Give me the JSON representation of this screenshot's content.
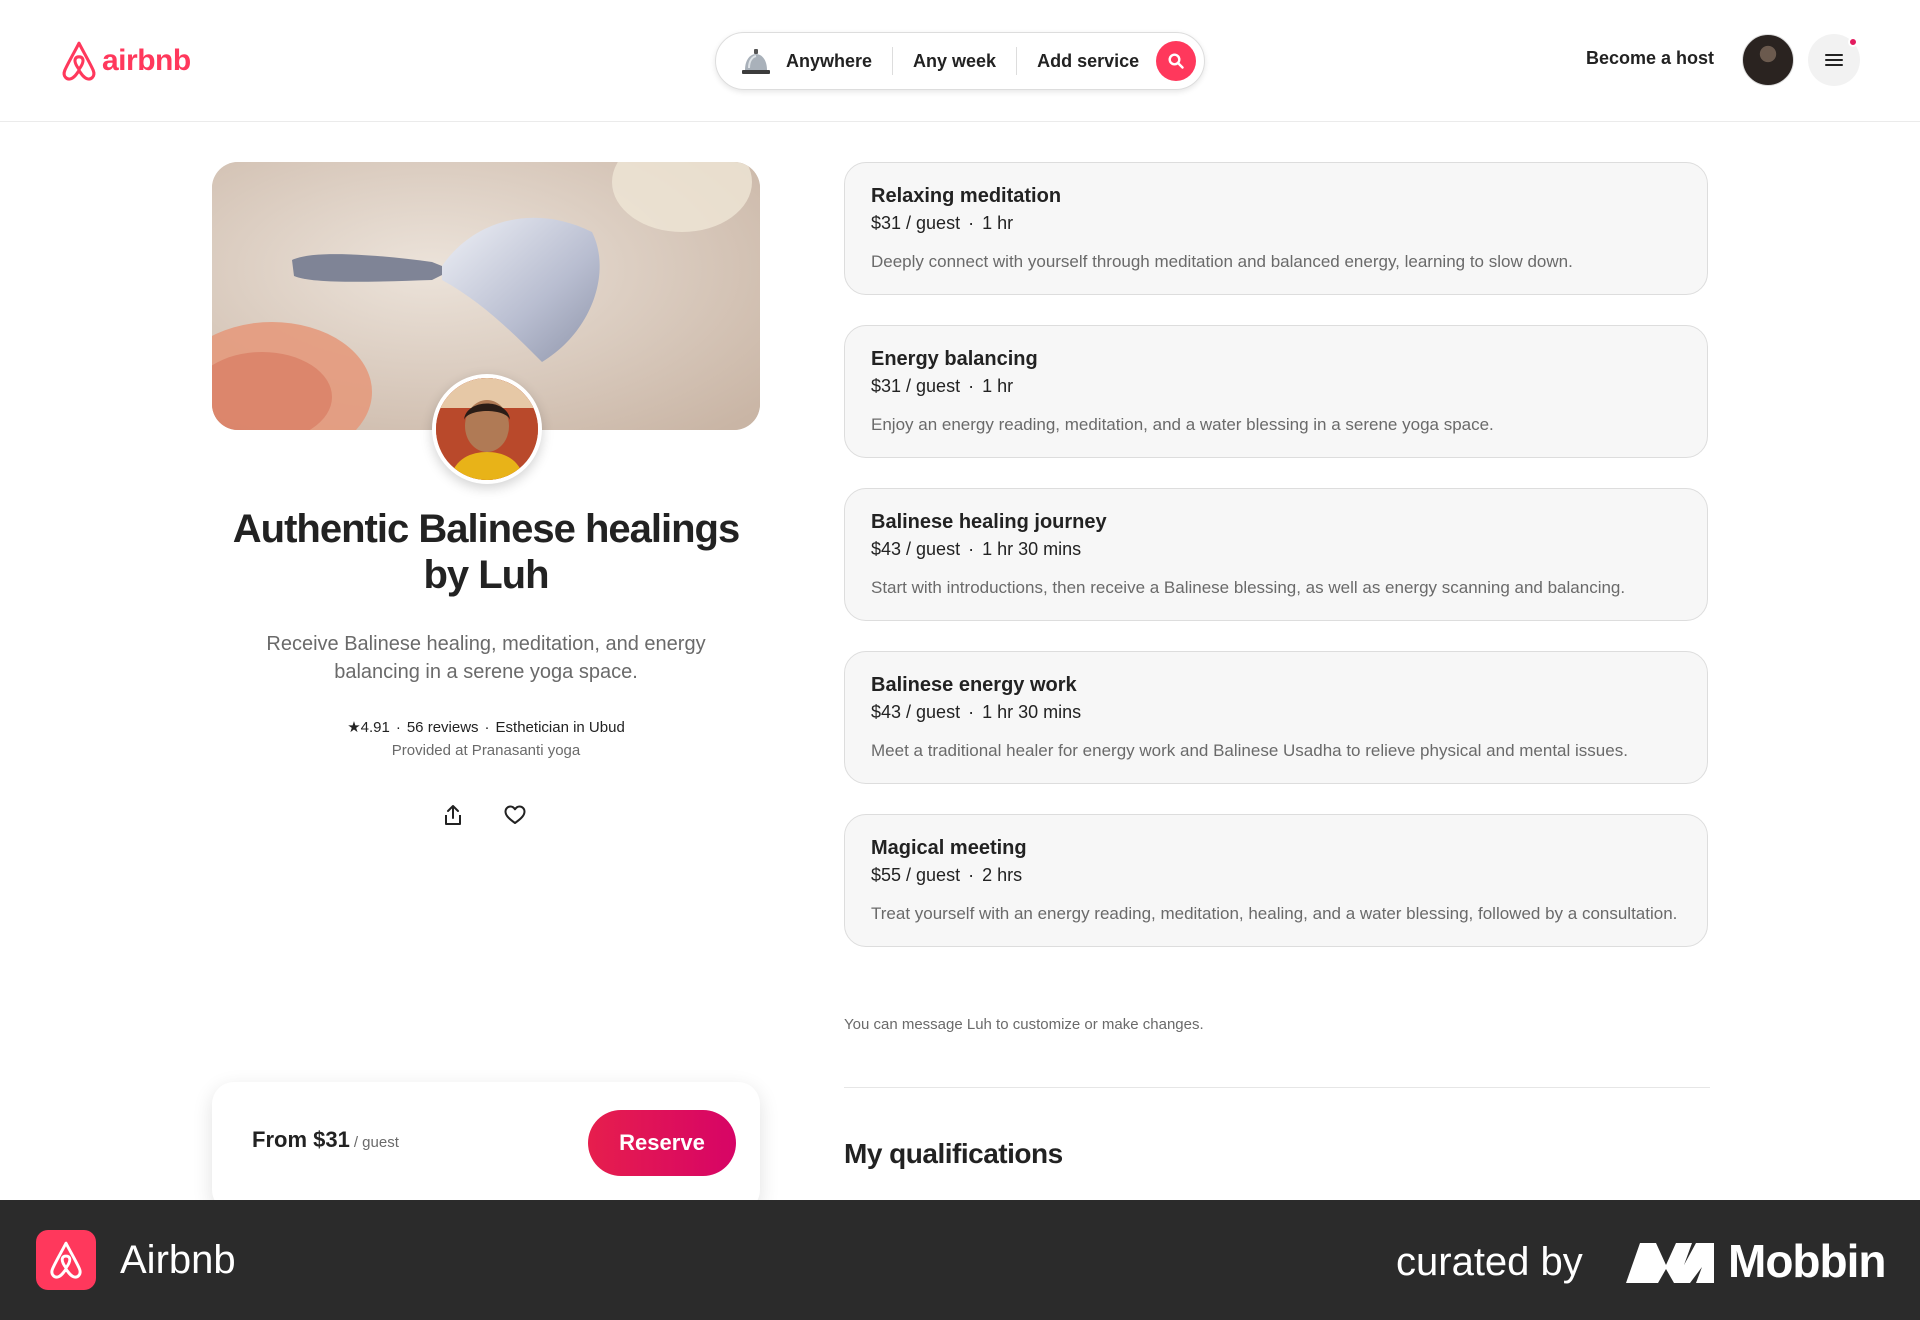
{
  "header": {
    "logo_text": "airbnb",
    "search": {
      "where": "Anywhere",
      "when": "Any week",
      "what": "Add service"
    },
    "become_host": "Become a host"
  },
  "listing": {
    "title": "Authentic Balinese healings by Luh",
    "subtitle": "Receive Balinese healing, meditation, and energy balancing in a serene yoga space.",
    "rating": "4.91",
    "reviews": "56 reviews",
    "role": "Esthetician in Ubud",
    "location": "Provided at Pranasanti yoga"
  },
  "reserve": {
    "price": "From $31",
    "unit": "/ guest",
    "button": "Reserve"
  },
  "services": [
    {
      "name": "Relaxing meditation",
      "price": "$31 / guest",
      "duration": "1 hr",
      "desc": "Deeply connect with yourself through meditation and balanced energy, learning to slow down."
    },
    {
      "name": "Energy balancing",
      "price": "$31 / guest",
      "duration": "1 hr",
      "desc": "Enjoy an energy reading, meditation, and a water blessing in a serene yoga space."
    },
    {
      "name": "Balinese healing journey",
      "price": "$43 / guest",
      "duration": "1 hr 30 mins",
      "desc": "Start with introductions, then receive a Balinese blessing, as well as energy scanning and balancing."
    },
    {
      "name": "Balinese energy work",
      "price": "$43 / guest",
      "duration": "1 hr 30 mins",
      "desc": "Meet a traditional healer for energy work and Balinese Usadha to relieve physical and mental issues."
    },
    {
      "name": "Magical meeting",
      "price": "$55 / guest",
      "duration": "2 hrs",
      "desc": "Treat yourself with an energy reading, meditation, healing, and a water blessing, followed by a consultation."
    }
  ],
  "message_note": "You can message Luh to customize or make changes.",
  "qualifications_title": "My qualifications",
  "footer": {
    "app_name": "Airbnb",
    "curated_by": "curated by",
    "brand": "Mobbin"
  },
  "colors": {
    "brand": "#ff385c",
    "reserve_gradient_start": "#e61e4d",
    "reserve_gradient_end": "#d70466",
    "footer_bg": "#2b2b2b"
  },
  "icons": [
    "airbnb-logo-icon",
    "service-bell-icon",
    "search-icon",
    "menu-icon",
    "star-icon",
    "share-icon",
    "heart-icon",
    "mobbin-logo-icon"
  ]
}
